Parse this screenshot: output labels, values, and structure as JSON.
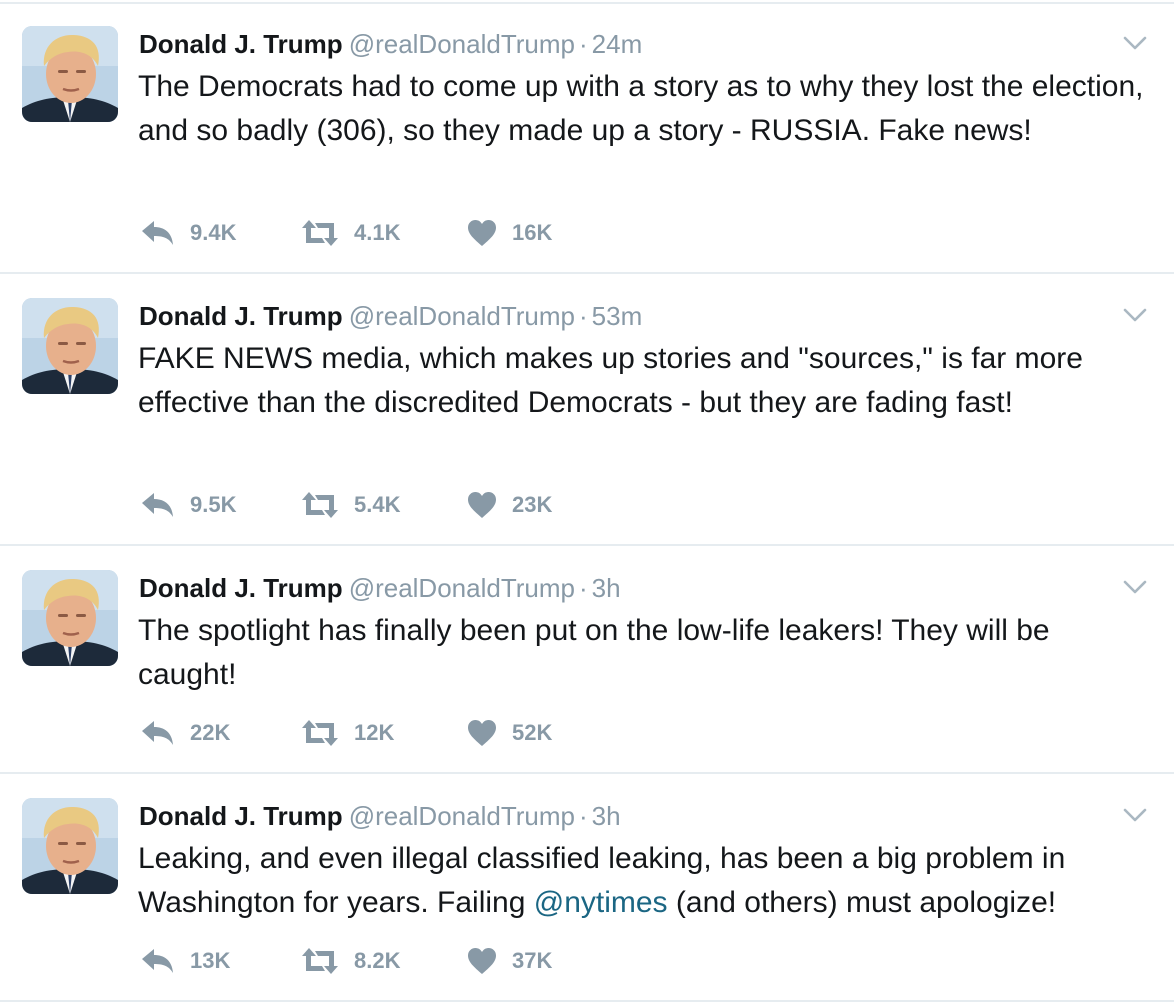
{
  "author": {
    "name": "Donald J. Trump",
    "handle": "@realDonaldTrump"
  },
  "tweets": [
    {
      "time": "24m",
      "text": "The Democrats had to come up with a story as to why they lost the election, and so badly (306), so they made up a story - RUSSIA. Fake news!",
      "replies": "9.4K",
      "retweets": "4.1K",
      "likes": "16K"
    },
    {
      "time": "53m",
      "text": "FAKE NEWS media, which makes up stories and \"sources,\" is far more effective than the discredited Democrats - but they are fading fast!",
      "replies": "9.5K",
      "retweets": "5.4K",
      "likes": "23K"
    },
    {
      "time": "3h",
      "text": "The spotlight has finally been put on the low-life leakers! They will be caught!",
      "replies": "22K",
      "retweets": "12K",
      "likes": "52K"
    },
    {
      "time": "3h",
      "text_before": "Leaking, and even illegal classified leaking, has been a big problem in Washington for years. Failing ",
      "mention": "@nytimes",
      "text_after": " (and others) must apologize!",
      "replies": "13K",
      "retweets": "8.2K",
      "likes": "37K"
    }
  ],
  "icons": {
    "reply": "reply-icon",
    "retweet": "retweet-icon",
    "like": "heart-icon",
    "menu": "chevron-down-icon"
  },
  "colors": {
    "text": "#14171a",
    "secondary": "#8899a6",
    "mention": "#1b6683",
    "divider": "#e6ecf0"
  }
}
